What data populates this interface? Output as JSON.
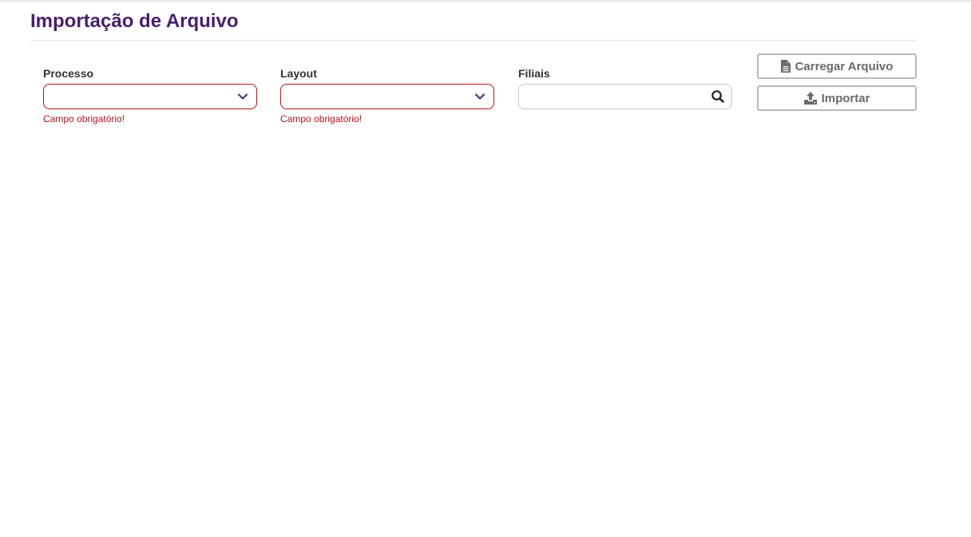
{
  "page": {
    "title": "Importação de Arquivo"
  },
  "form": {
    "processo": {
      "label": "Processo",
      "value": "",
      "error": "Campo obrigatório!"
    },
    "layout": {
      "label": "Layout",
      "value": "",
      "error": "Campo obrigatório!"
    },
    "filiais": {
      "label": "Filiais",
      "value": "",
      "placeholder": ""
    }
  },
  "actions": {
    "carregar_label": "Carregar Arquivo",
    "carregar_icon": "file-icon",
    "importar_label": "Importar",
    "importar_icon": "upload-icon"
  },
  "colors": {
    "title": "#4a1e6b",
    "accent": "#5b2a86",
    "error": "#b5121b",
    "button_text": "#6a6a6a"
  }
}
